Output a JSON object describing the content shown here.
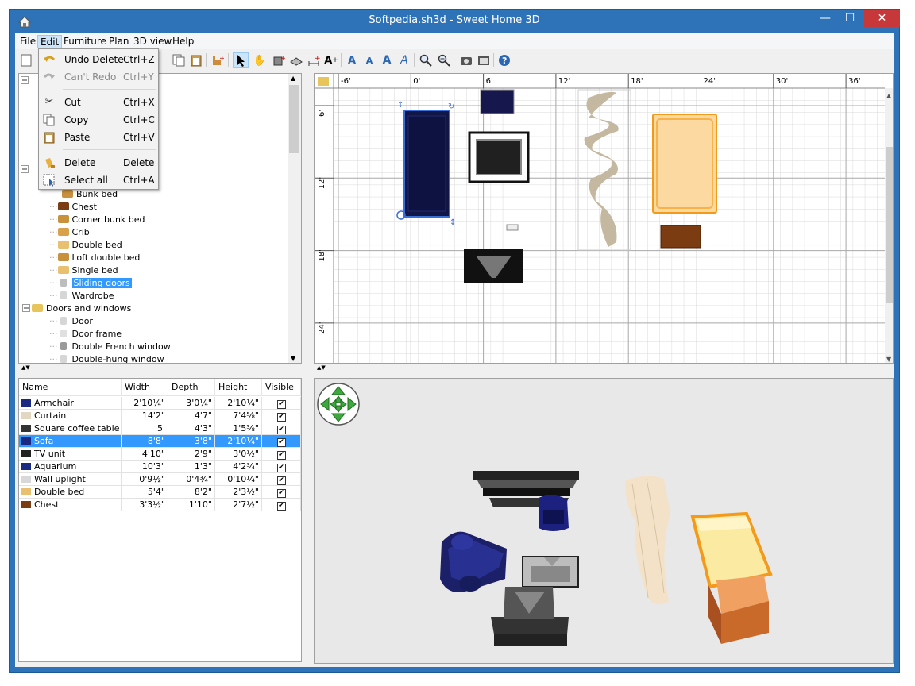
{
  "window": {
    "title": "Softpedia.sh3d - Sweet Home 3D"
  },
  "menubar": [
    "File",
    "Edit",
    "Furniture",
    "Plan",
    "3D view",
    "Help"
  ],
  "edit_menu": {
    "items": [
      {
        "label": "Undo Delete",
        "shortcut": "Ctrl+Z",
        "icon": "undo-icon",
        "enabled": true
      },
      {
        "label": "Can't Redo",
        "shortcut": "Ctrl+Y",
        "icon": "redo-icon",
        "enabled": false
      },
      {
        "label": "Cut",
        "shortcut": "Ctrl+X",
        "icon": "cut-icon",
        "enabled": true
      },
      {
        "label": "Copy",
        "shortcut": "Ctrl+C",
        "icon": "copy-icon",
        "enabled": true
      },
      {
        "label": "Paste",
        "shortcut": "Ctrl+V",
        "icon": "paste-icon",
        "enabled": true
      },
      {
        "label": "Delete",
        "shortcut": "Delete",
        "icon": "delete-icon",
        "enabled": true
      },
      {
        "label": "Select all",
        "shortcut": "Ctrl+A",
        "icon": "select-all-icon",
        "enabled": true
      }
    ]
  },
  "catalog": {
    "items": [
      {
        "label": "Bunk bed",
        "type": "item",
        "color": "#c8913c"
      },
      {
        "label": "Chest",
        "type": "item",
        "color": "#7a3c10"
      },
      {
        "label": "Corner bunk bed",
        "type": "item",
        "color": "#c8913c"
      },
      {
        "label": "Crib",
        "type": "item",
        "color": "#d9a24a"
      },
      {
        "label": "Double bed",
        "type": "item",
        "color": "#e8c070"
      },
      {
        "label": "Loft double bed",
        "type": "item",
        "color": "#c8913c"
      },
      {
        "label": "Single bed",
        "type": "item",
        "color": "#e8c070"
      },
      {
        "label": "Sliding doors",
        "type": "item",
        "color": "#bdbdbd",
        "selected": true
      },
      {
        "label": "Wardrobe",
        "type": "item",
        "color": "#d6d6d6"
      },
      {
        "label": "Doors and windows",
        "type": "folder",
        "color": "#e8c55a"
      },
      {
        "label": "Door",
        "type": "item",
        "color": "#d6d6d6"
      },
      {
        "label": "Door frame",
        "type": "item",
        "color": "#e0e0e0"
      },
      {
        "label": "Double French window",
        "type": "item",
        "color": "#9a9a9a"
      },
      {
        "label": "Double-hung window",
        "type": "item",
        "color": "#d6d6d6"
      }
    ]
  },
  "furniture_table": {
    "columns": [
      "Name",
      "Width",
      "Depth",
      "Height",
      "Visible"
    ],
    "rows": [
      {
        "name": "Armchair",
        "width": "2'10¼\"",
        "depth": "3'0¼\"",
        "height": "2'10¼\"",
        "visible": true,
        "color": "#1a2a80"
      },
      {
        "name": "Curtain",
        "width": "14'2\"",
        "depth": "4'7\"",
        "height": "7'4⅝\"",
        "visible": true,
        "color": "#e2d8c2"
      },
      {
        "name": "Square coffee table",
        "width": "5'",
        "depth": "4'3\"",
        "height": "1'5⅜\"",
        "visible": true,
        "color": "#333333"
      },
      {
        "name": "Sofa",
        "width": "8'8\"",
        "depth": "3'8\"",
        "height": "2'10¼\"",
        "visible": true,
        "color": "#1a2a80",
        "selected": true
      },
      {
        "name": "TV unit",
        "width": "4'10\"",
        "depth": "2'9\"",
        "height": "3'0½\"",
        "visible": true,
        "color": "#222222"
      },
      {
        "name": "Aquarium",
        "width": "10'3\"",
        "depth": "1'3\"",
        "height": "4'2¾\"",
        "visible": true,
        "color": "#1a2a80"
      },
      {
        "name": "Wall uplight",
        "width": "0'9½\"",
        "depth": "0'4¾\"",
        "height": "0'10¼\"",
        "visible": true,
        "color": "#d8d8d8"
      },
      {
        "name": "Double bed",
        "width": "5'4\"",
        "depth": "8'2\"",
        "height": "2'3½\"",
        "visible": true,
        "color": "#e8c070"
      },
      {
        "name": "Chest",
        "width": "3'3½\"",
        "depth": "1'10\"",
        "height": "2'7½\"",
        "visible": true,
        "color": "#7a3c10"
      }
    ]
  },
  "plan": {
    "x_ruler": [
      "-6'",
      "0'",
      "6'",
      "12'",
      "18'",
      "24'",
      "30'",
      "36'"
    ],
    "y_ruler": [
      "6'",
      "12'",
      "18'",
      "24'"
    ]
  },
  "colors": {
    "titlebar": "#2e73b8",
    "selection": "#3399ff",
    "sofa": "#141a5c",
    "bed": "#fbd9a0",
    "chest": "#7a3c10"
  }
}
